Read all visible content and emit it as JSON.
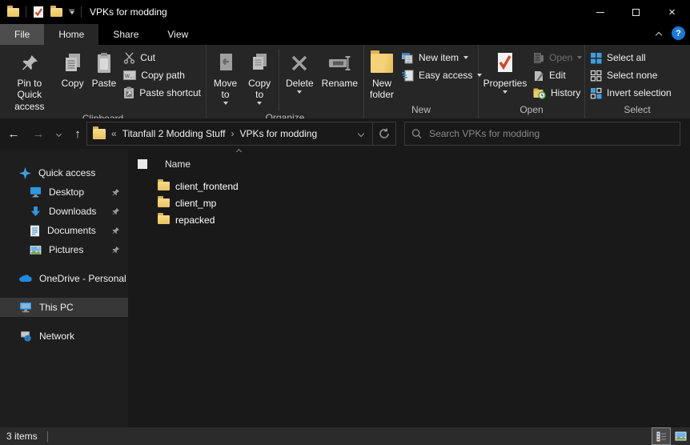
{
  "titlebar": {
    "title": "VPKs for modding"
  },
  "tabs": {
    "file": "File",
    "home": "Home",
    "share": "Share",
    "view": "View"
  },
  "ribbon": {
    "clipboard": {
      "label": "Clipboard",
      "pin": "Pin to Quick access",
      "copy": "Copy",
      "paste": "Paste",
      "cut": "Cut",
      "copy_path": "Copy path",
      "paste_shortcut": "Paste shortcut"
    },
    "organize": {
      "label": "Organize",
      "move_to": "Move to",
      "copy_to": "Copy to",
      "delete": "Delete",
      "rename": "Rename"
    },
    "new_group": {
      "label": "New",
      "new_folder": "New folder",
      "new_item": "New item",
      "easy_access": "Easy access"
    },
    "open_group": {
      "label": "Open",
      "properties": "Properties",
      "open": "Open",
      "edit": "Edit",
      "history": "History"
    },
    "select_group": {
      "label": "Select",
      "select_all": "Select all",
      "select_none": "Select none",
      "invert": "Invert selection"
    }
  },
  "navbar": {
    "breadcrumb_prefix": "«",
    "crumb_parent": "Titanfall 2 Modding Stuff",
    "crumb_sep": "›",
    "crumb_current": "VPKs for modding",
    "search_placeholder": "Search VPKs for modding"
  },
  "sidebar": {
    "quick_access_label": "Quick access",
    "pinned": [
      {
        "label": "Desktop"
      },
      {
        "label": "Downloads"
      },
      {
        "label": "Documents"
      },
      {
        "label": "Pictures"
      }
    ],
    "onedrive_label": "OneDrive - Personal",
    "this_pc_label": "This PC",
    "network_label": "Network"
  },
  "files": {
    "name_column": "Name",
    "items": [
      {
        "name": "client_frontend"
      },
      {
        "name": "client_mp"
      },
      {
        "name": "repacked"
      }
    ]
  },
  "statusbar": {
    "count": "3 items"
  },
  "icons": {
    "window-icon": "yellow-folder",
    "qat-properties-icon": "page-with-orange-check",
    "qat-new-folder-icon": "yellow-folder",
    "search-icon": "magnifier",
    "refresh-icon": "circular-arrow",
    "back-icon": "left-arrow",
    "forward-icon": "right-arrow",
    "up-icon": "up-arrow",
    "help-icon": "question-mark-circle"
  },
  "colors": {
    "accent_blue": "#2f96e0",
    "folder_yellow": "#efcd6d",
    "check_orange": "#d24726",
    "help_blue": "#1a78d8",
    "history_green": "#4ca64c",
    "selected_row": "#373737",
    "ribbon_bg": "#262626",
    "panel_bg": "#191919",
    "statusbar_bg": "#2b2b2b"
  }
}
